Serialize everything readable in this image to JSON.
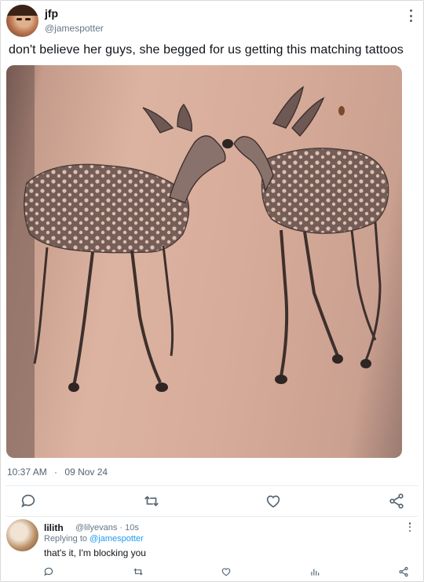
{
  "post": {
    "author_name": "jfp",
    "author_handle": "@jamespotter",
    "text": "don't believe her guys, she begged for us getting this matching tattoos",
    "time": "10:37 AM",
    "separator": "·",
    "date": "09 Nov 24"
  },
  "actions": {
    "icons": [
      "reply-icon",
      "retweet-icon",
      "like-icon",
      "share-icon"
    ]
  },
  "reply": {
    "author_name": "lilith",
    "author_handle": "@lilyevans",
    "separator": "·",
    "age": "10s",
    "replying_to_prefix": "Replying to",
    "replying_to_handle": "@jamespotter",
    "text": "that's it, I'm blocking you",
    "icons": [
      "reply-icon",
      "retweet-icon",
      "like-icon",
      "views-icon",
      "share-icon"
    ]
  },
  "colors": {
    "link": "#1d9bf0",
    "secondary_text": "#536471",
    "divider": "#e6ecf0"
  }
}
